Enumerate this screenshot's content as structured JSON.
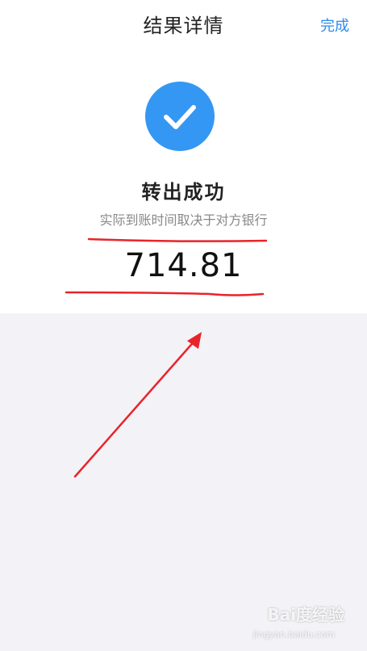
{
  "header": {
    "title": "结果详情",
    "done_label": "完成"
  },
  "result": {
    "icon": "checkmark-icon",
    "title": "转出成功",
    "subtitle": "实际到账时间取决于对方银行",
    "amount": "714.81"
  },
  "watermark": {
    "text": "Bai度经验",
    "url": "jingyan.baidu.com"
  },
  "colors": {
    "accent": "#3497f3",
    "link": "#2d8bf0",
    "annotation": "#e8242a",
    "background": "#f3f2f7"
  }
}
